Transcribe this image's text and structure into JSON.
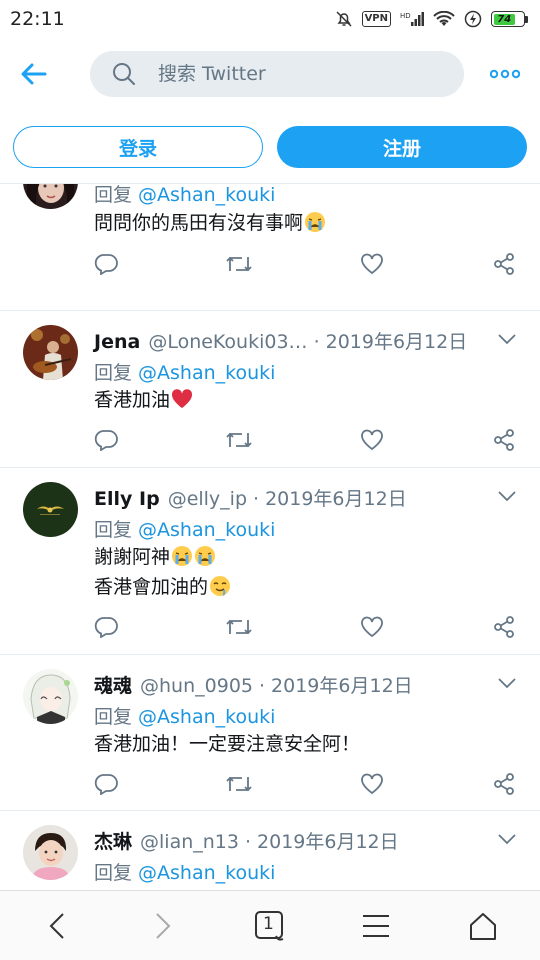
{
  "status_bar": {
    "time": "22:11",
    "vpn": "VPN",
    "battery": "74"
  },
  "header": {
    "search_placeholder": "搜索 Twitter"
  },
  "auth": {
    "login": "登录",
    "signup": "注册"
  },
  "reply_prefix": "回复",
  "tweets": [
    {
      "name": "",
      "handle": "",
      "date": "",
      "reply_to": "@Ashan_kouki",
      "text": "問問你的馬田有沒有事啊",
      "emojis": [
        "crying-face"
      ]
    },
    {
      "name": "Jena",
      "handle": "@LoneKouki03…",
      "date": "2019年6月12日",
      "reply_to": "@Ashan_kouki",
      "text": "香港加油",
      "emojis": [
        "red-heart"
      ]
    },
    {
      "name": "Elly Ip",
      "handle": "@elly_ip",
      "date": "2019年6月12日",
      "reply_to": "@Ashan_kouki",
      "text_line1": "謝謝阿神",
      "text_line2": "香港會加油的",
      "emojis": [
        "crying-face",
        "crying-face",
        "drooling-face"
      ]
    },
    {
      "name": "魂魂",
      "handle": "@hun_0905",
      "date": "2019年6月12日",
      "reply_to": "@Ashan_kouki",
      "text": "香港加油！一定要注意安全阿！"
    },
    {
      "name": "杰琳",
      "handle": "@lian_n13",
      "date": "2019年6月12日",
      "reply_to": "@Ashan_kouki"
    }
  ],
  "icons": {
    "back": "arrow-left-icon",
    "search": "search-icon",
    "more": "more-dots-icon",
    "reply": "reply-icon",
    "retweet": "retweet-icon",
    "like": "heart-icon",
    "share": "share-icon",
    "caret": "chevron-down-icon"
  },
  "bottom_nav": {
    "tab_count": "1"
  },
  "colors": {
    "twitter_blue": "#1da1f2",
    "link_blue": "#1b95e0",
    "gray": "#657786",
    "search_bg": "#e6ecf0"
  }
}
